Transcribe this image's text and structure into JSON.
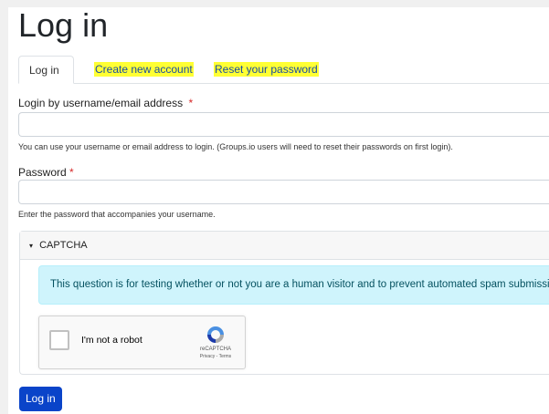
{
  "page": {
    "title": "Log in"
  },
  "tabs": [
    {
      "label": "Log in",
      "active": true
    },
    {
      "label": "Create new account",
      "highlighted": true
    },
    {
      "label": "Reset your password",
      "highlighted": true
    }
  ],
  "form": {
    "username": {
      "label": "Login by username/email address",
      "required_marker": "*",
      "value": "",
      "help": "You can use your username or email address to login. (Groups.io users will need to reset their passwords on first login)."
    },
    "password": {
      "label": "Password",
      "required_marker": "*",
      "value": "",
      "help": "Enter the password that accompanies your username."
    },
    "captcha": {
      "toggle_icon": "▾",
      "title": "CAPTCHA",
      "description": "This question is for testing whether or not you are a human visitor and to prevent automated spam submissions.",
      "recaptcha": {
        "checkbox_label": "I'm not a robot",
        "brand": "reCAPTCHA",
        "privacy": "Privacy",
        "separator": " - ",
        "terms": "Terms"
      }
    },
    "submit_label": "Log in"
  },
  "colors": {
    "highlight": "#ffff33",
    "primary_button": "#0a44c9",
    "link": "#1a4ea0",
    "alert_bg": "#cff4fc",
    "required": "#d62828"
  }
}
